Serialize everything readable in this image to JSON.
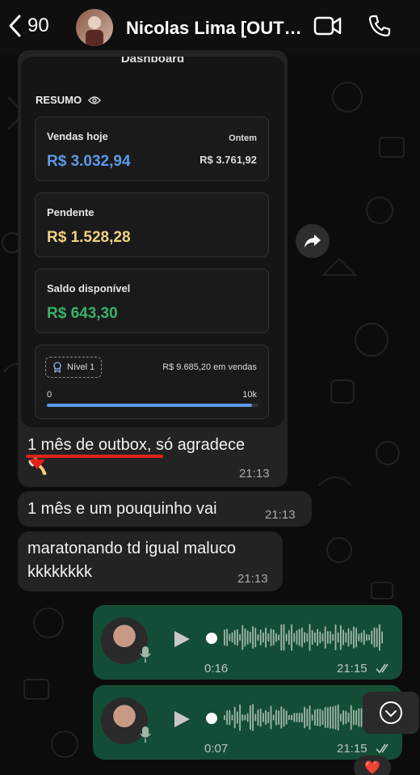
{
  "header": {
    "back_count": "90",
    "contact_name": "Nicolas Lima [OUTB..."
  },
  "dashboard": {
    "title": "Dashboard",
    "resumo": "RESUMO",
    "sales_today_label": "Vendas hoje",
    "sales_today_value": "R$ 3.032,94",
    "yesterday_label": "Ontem",
    "yesterday_value": "R$ 3.761,92",
    "pending_label": "Pendente",
    "pending_value": "R$ 1.528,28",
    "balance_label": "Saldo disponível",
    "balance_value": "R$ 643,30",
    "level_label": "Nível 1",
    "sales_total": "R$ 9.685,20 em vendas",
    "progress_min": "0",
    "progress_max": "10k",
    "progress_fraction": 0.97
  },
  "messages": [
    {
      "text_a": "1 mês de outbox",
      "text_b": ", só agradece",
      "emoji": "🪓",
      "time": "21:13"
    },
    {
      "text": "1 mês e um pouquinho vai",
      "time": "21:13"
    },
    {
      "text_l1": "maratonando td igual maluco",
      "text_l2": "kkkkkkkk",
      "time": "21:13"
    }
  ],
  "voice": [
    {
      "duration": "0:16",
      "time": "21:15"
    },
    {
      "duration": "0:07",
      "time": "21:15"
    }
  ],
  "reaction": "❤️",
  "colors": {
    "sales": "#5b9ae8",
    "pending": "#f2d083",
    "balance": "#36b36a",
    "outgoing": "#144d36",
    "incoming": "#232323",
    "underline": "#e0241b"
  }
}
